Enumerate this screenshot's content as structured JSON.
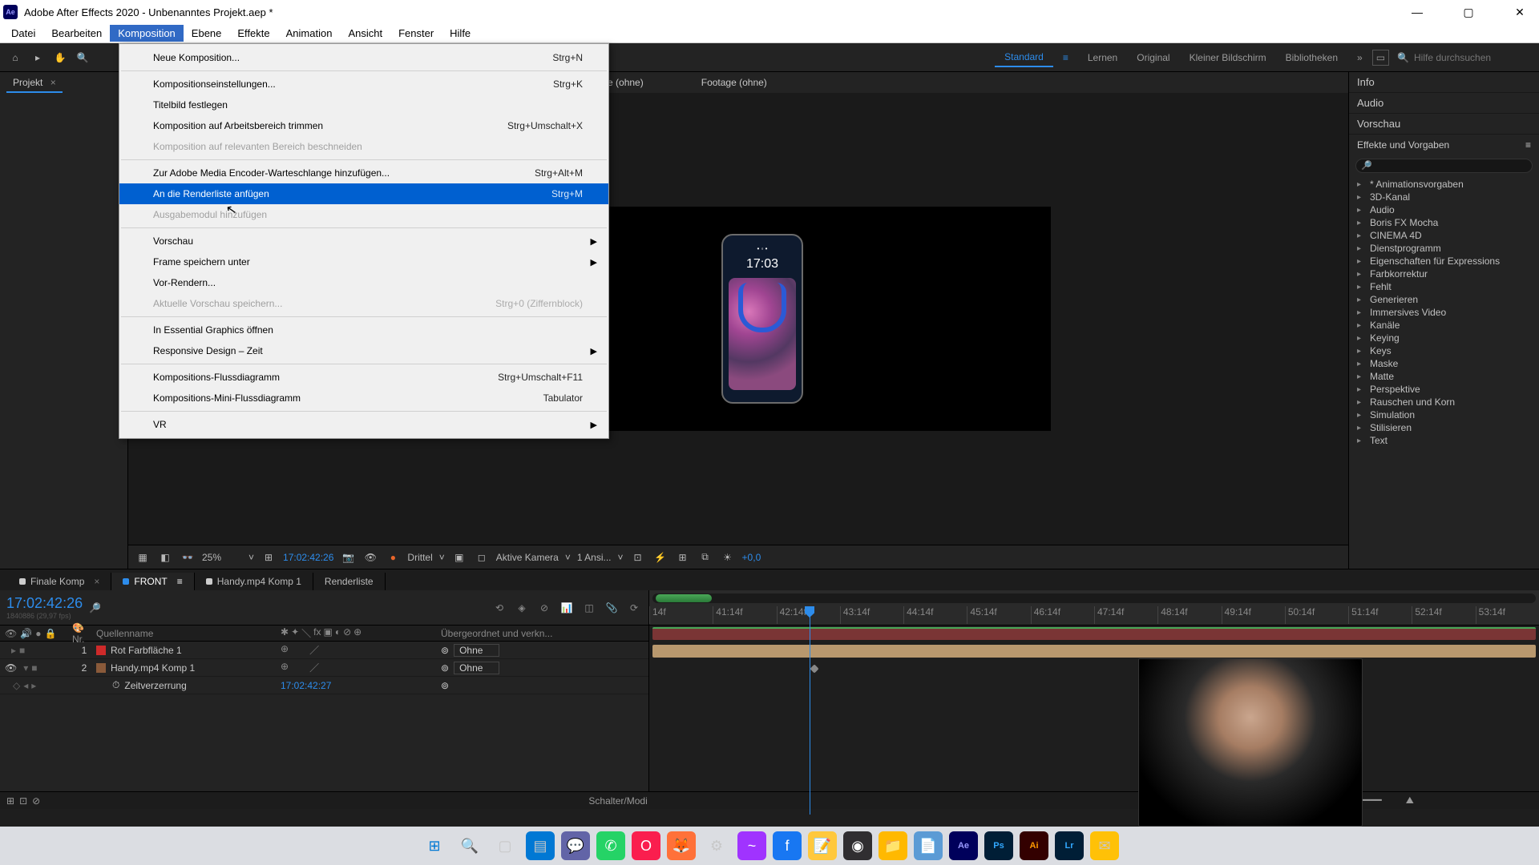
{
  "window": {
    "title": "Adobe After Effects 2020 - Unbenanntes Projekt.aep *"
  },
  "menubar": [
    "Datei",
    "Bearbeiten",
    "Komposition",
    "Ebene",
    "Effekte",
    "Animation",
    "Ansicht",
    "Fenster",
    "Hilfe"
  ],
  "dropdown": {
    "items": [
      {
        "label": "Neue Komposition...",
        "shortcut": "Strg+N"
      },
      {
        "sep": true
      },
      {
        "label": "Kompositionseinstellungen...",
        "shortcut": "Strg+K"
      },
      {
        "label": "Titelbild festlegen"
      },
      {
        "label": "Komposition auf Arbeitsbereich trimmen",
        "shortcut": "Strg+Umschalt+X"
      },
      {
        "label": "Komposition auf relevanten Bereich beschneiden",
        "disabled": true
      },
      {
        "sep": true
      },
      {
        "label": "Zur Adobe Media Encoder-Warteschlange hinzufügen...",
        "shortcut": "Strg+Alt+M"
      },
      {
        "label": "An die Renderliste anfügen",
        "shortcut": "Strg+M",
        "highlight": true
      },
      {
        "label": "Ausgabemodul hinzufügen",
        "disabled": true
      },
      {
        "sep": true
      },
      {
        "label": "Vorschau",
        "submenu": true
      },
      {
        "label": "Frame speichern unter",
        "submenu": true
      },
      {
        "label": "Vor-Rendern..."
      },
      {
        "label": "Aktuelle Vorschau speichern...",
        "shortcut": "Strg+0 (Ziffernblock)",
        "disabled": true
      },
      {
        "sep": true
      },
      {
        "label": "In Essential Graphics öffnen"
      },
      {
        "label": "Responsive Design – Zeit",
        "submenu": true
      },
      {
        "sep": true
      },
      {
        "label": "Kompositions-Flussdiagramm",
        "shortcut": "Strg+Umschalt+F11"
      },
      {
        "label": "Kompositions-Mini-Flussdiagramm",
        "shortcut": "Tabulator"
      },
      {
        "sep": true
      },
      {
        "label": "VR",
        "submenu": true
      }
    ]
  },
  "workspaces": {
    "active": "Standard",
    "items": [
      "Standard",
      "Lernen",
      "Original",
      "Kleiner Bildschirm",
      "Bibliotheken"
    ]
  },
  "search_placeholder": "Hilfe durchsuchen",
  "project_tab": "Projekt",
  "viewer": {
    "tabs": {
      "layer": "Ebene  (ohne)",
      "footage": "Footage  (ohne)"
    },
    "zoom": "25%",
    "timecode": "17:02:42:26",
    "res": "Drittel",
    "camera": "Aktive Kamera",
    "views": "1 Ansi...",
    "exposure": "+0,0"
  },
  "phone_time": "17:03",
  "right_panels": {
    "info": "Info",
    "audio": "Audio",
    "preview": "Vorschau",
    "effects": "Effekte und Vorgaben"
  },
  "effects_tree": [
    "* Animationsvorgaben",
    "3D-Kanal",
    "Audio",
    "Boris FX Mocha",
    "CINEMA 4D",
    "Dienstprogramm",
    "Eigenschaften für Expressions",
    "Farbkorrektur",
    "Fehlt",
    "Generieren",
    "Immersives Video",
    "Kanäle",
    "Keying",
    "Keys",
    "Maske",
    "Matte",
    "Perspektive",
    "Rauschen und Korn",
    "Simulation",
    "Stilisieren",
    "Text"
  ],
  "timeline": {
    "tc": "17:02:42:26",
    "sub": "1840886 (29,97 fps)",
    "tabs": [
      {
        "label": "Finale Komp",
        "close": true
      },
      {
        "label": "FRONT",
        "active": true,
        "menu": true
      },
      {
        "label": "Handy.mp4 Komp 1"
      },
      {
        "label": "Renderliste"
      }
    ],
    "colhead": {
      "nr": "Nr.",
      "source": "Quellenname",
      "parent": "Übergeordnet und verkn..."
    },
    "rows": [
      {
        "num": "1",
        "name": "Rot Farbfläche 1",
        "color": "#ce2a2a",
        "parent": "Ohne"
      },
      {
        "num": "2",
        "name": "Handy.mp4 Komp 1",
        "color": "#8a5a3a",
        "parent": "Ohne",
        "eye": true
      }
    ],
    "subrow": {
      "name": "Zeitverzerrung",
      "value": "17:02:42:27"
    },
    "ruler": [
      "14f",
      "41:14f",
      "42:14f",
      "43:14f",
      "44:14f",
      "45:14f",
      "46:14f",
      "47:14f",
      "48:14f",
      "49:14f",
      "50:14f",
      "51:14f",
      "52:14f",
      "53:14f"
    ],
    "footer": "Schalter/Modi"
  },
  "taskbar_icons": [
    "win",
    "search",
    "tasks",
    "explorer",
    "teams",
    "whatsapp",
    "opera",
    "firefox",
    "app1",
    "messenger",
    "facebook",
    "notes",
    "obs",
    "folder",
    "editor",
    "ae",
    "ps",
    "ai",
    "lr",
    "mail"
  ]
}
